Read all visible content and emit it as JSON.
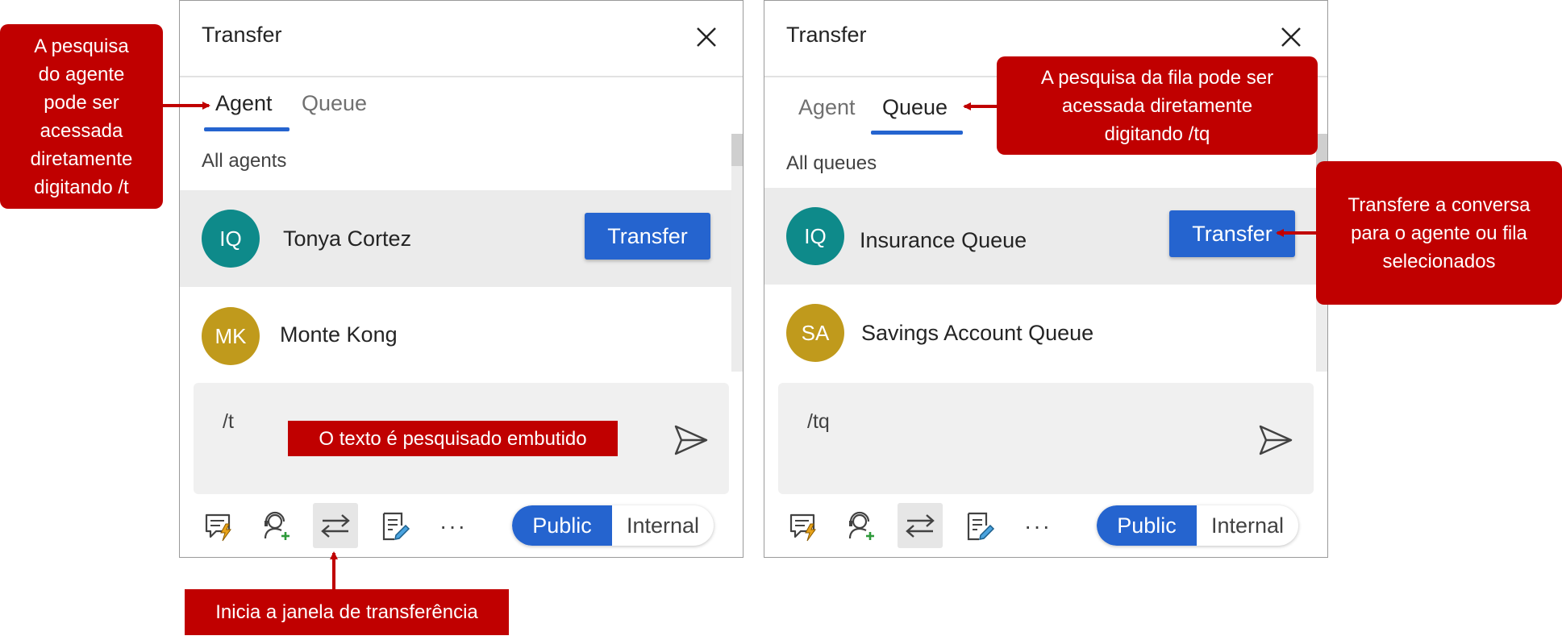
{
  "left_panel": {
    "title": "Transfer",
    "tabs": [
      {
        "label": "Agent",
        "active": true
      },
      {
        "label": "Queue",
        "active": false
      }
    ],
    "list_title": "All agents",
    "items": [
      {
        "initials": "IQ",
        "name": "Tonya Cortez",
        "avatar_color": "#0e8a8a",
        "selected": true
      },
      {
        "initials": "MK",
        "name": "Monte Kong",
        "avatar_color": "#c09a1c",
        "selected": false
      }
    ],
    "transfer_button": "Transfer",
    "compose_text": "/t",
    "toggle": {
      "public": "Public",
      "internal": "Internal"
    }
  },
  "right_panel": {
    "title": "Transfer",
    "tabs": [
      {
        "label": "Agent",
        "active": false
      },
      {
        "label": "Queue",
        "active": true
      }
    ],
    "list_title": "All queues",
    "items": [
      {
        "initials": "IQ",
        "name": "Insurance Queue",
        "avatar_color": "#0e8a8a",
        "selected": true
      },
      {
        "initials": "SA",
        "name": "Savings Account Queue",
        "avatar_color": "#c09a1c",
        "selected": false
      }
    ],
    "transfer_button": "Transfer",
    "compose_text": "/tq",
    "toggle": {
      "public": "Public",
      "internal": "Internal"
    }
  },
  "callouts": {
    "agent_search": "A pesquisa\ndo agente\npode ser\nacessada\ndiretamente\ndigitando /t",
    "queue_search": "A pesquisa da fila pode ser\nacessada diretamente\ndigitando /tq",
    "transfer_action": "Transfere a conversa\npara o agente ou fila\nselecionados",
    "inline_search": "O texto é pesquisado embutido",
    "open_transfer": "Inicia a janela de transferência"
  },
  "colors": {
    "accent": "#2564cf",
    "callout": "#c00000",
    "selected_row": "#ebebeb",
    "compose_bg": "#f0f0f0"
  },
  "icons": {
    "close": "close-icon",
    "send": "send-icon",
    "toolbar": [
      "quick-replies-icon",
      "consult-icon",
      "transfer-icon",
      "notes-icon",
      "more-icon"
    ]
  }
}
